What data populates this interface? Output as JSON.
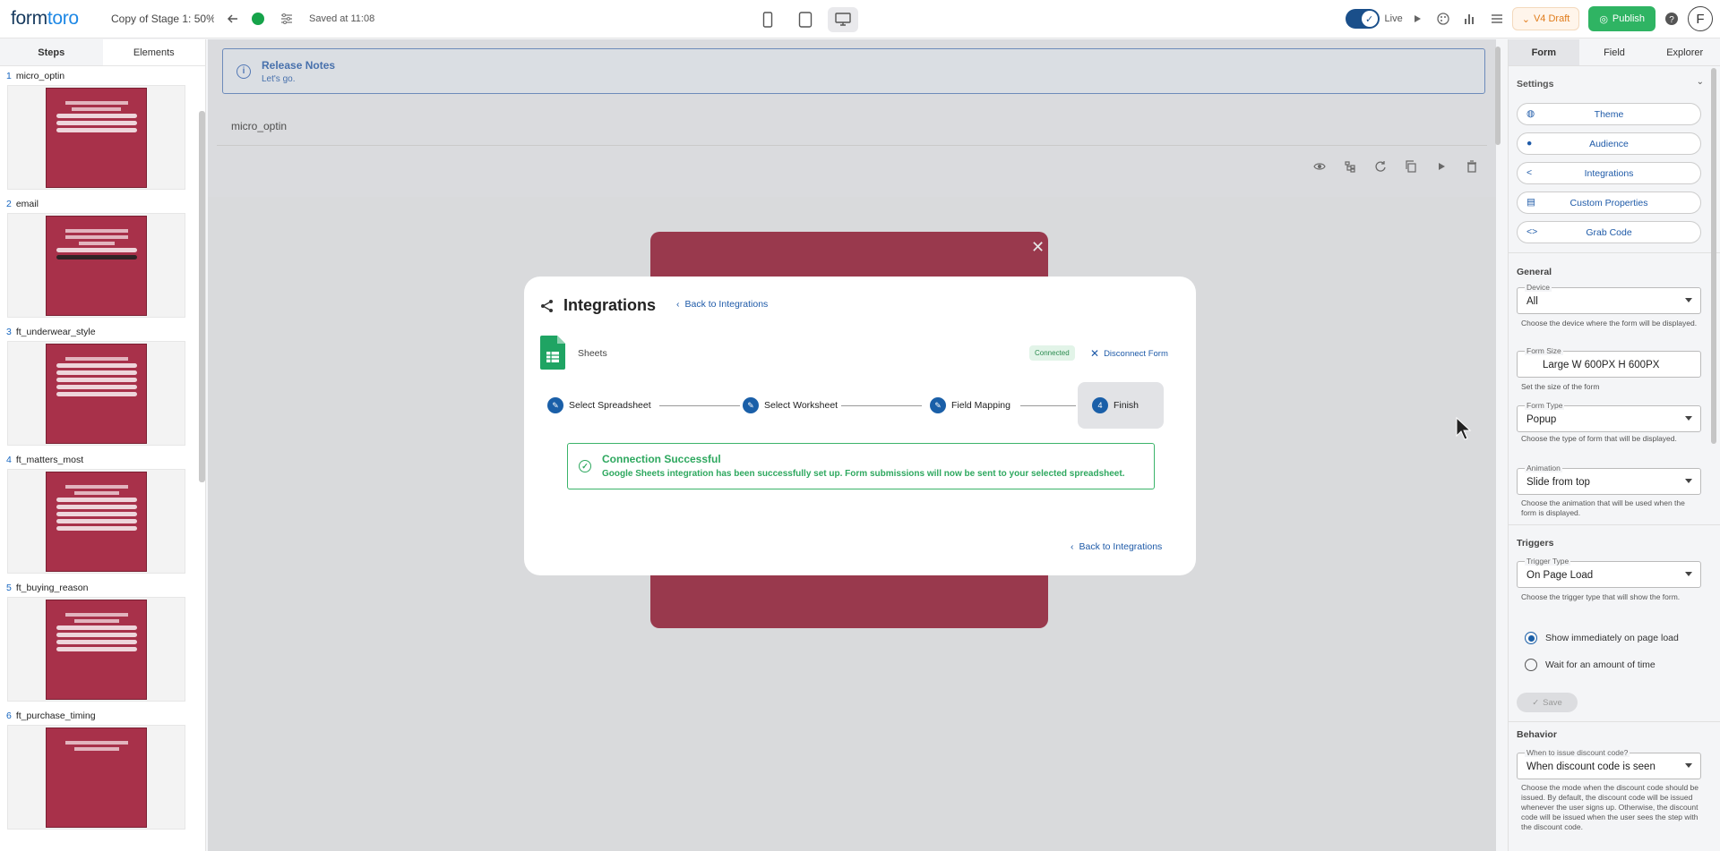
{
  "app": {
    "logo_a": "form",
    "logo_b": "toro",
    "doc_title": "Copy of Stage 1: 50% ...",
    "saved": "Saved at 11:08",
    "live_label": "Live",
    "draft_label": "V4 Draft",
    "publish_label": "Publish",
    "avatar_initial": "F"
  },
  "left": {
    "tabs": [
      "Steps",
      "Elements"
    ],
    "steps": [
      {
        "num": "1",
        "name": "micro_optin"
      },
      {
        "num": "2",
        "name": "email"
      },
      {
        "num": "3",
        "name": "ft_underwear_style"
      },
      {
        "num": "4",
        "name": "ft_matters_most"
      },
      {
        "num": "5",
        "name": "ft_buying_reason"
      },
      {
        "num": "6",
        "name": "ft_purchase_timing"
      }
    ]
  },
  "main": {
    "release_title": "Release Notes",
    "release_sub": "Let's go.",
    "step_name": "micro_optin"
  },
  "modal": {
    "title": "Integrations",
    "back_label": "Back to Integrations",
    "provider": "Sheets",
    "connected": "Connected",
    "disconnect": "Disconnect Form",
    "steps": [
      {
        "label": "Select Spreadsheet"
      },
      {
        "label": "Select Worksheet"
      },
      {
        "label": "Field Mapping"
      },
      {
        "num": "4",
        "label": "Finish"
      }
    ],
    "success_title": "Connection Successful",
    "success_text": "Google Sheets integration has been successfully set up. Form submissions will now be sent to your selected spreadsheet."
  },
  "right": {
    "tabs": [
      "Form",
      "Field",
      "Explorer"
    ],
    "settings": "Settings",
    "buttons": [
      "Theme",
      "Audience",
      "Integrations",
      "Custom Properties",
      "Grab Code"
    ],
    "general": "General",
    "device_label": "Device",
    "device_value": "All",
    "device_help": "Choose the device where the form will be displayed.",
    "size_label": "Form Size",
    "size_value": "Large  W 600PX  H 600PX",
    "size_help": "Set the size of the form",
    "type_label": "Form Type",
    "type_value": "Popup",
    "type_help": "Choose the type of form that will be displayed.",
    "anim_label": "Animation",
    "anim_value": "Slide from top",
    "anim_help": "Choose the animation that will be used when the form is displayed.",
    "triggers": "Triggers",
    "trigger_label": "Trigger Type",
    "trigger_value": "On Page Load",
    "trigger_help": "Choose the trigger type that will show the form.",
    "radio1": "Show immediately on page load",
    "radio2": "Wait for an amount of time",
    "save": "Save",
    "behavior": "Behavior",
    "discount_label": "When to issue discount code?",
    "discount_value": "When discount code is seen",
    "discount_help": "Choose the mode when the discount code should be issued. By default, the discount code will be issued whenever the user signs up. Otherwise, the discount code will be issued when the user sees the step with the discount code."
  }
}
